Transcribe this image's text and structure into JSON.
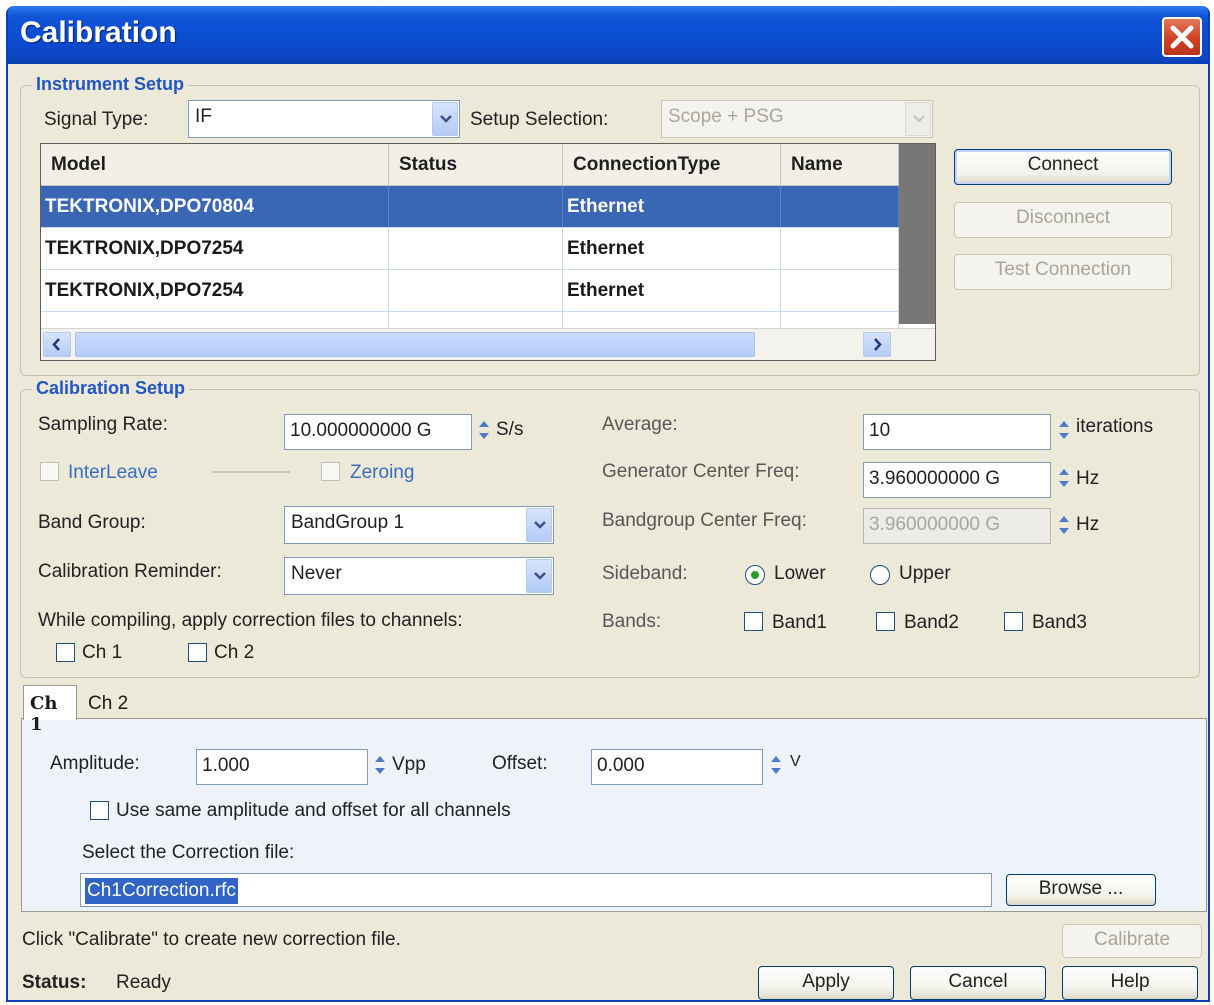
{
  "window": {
    "title": "Calibration"
  },
  "instrument_setup": {
    "title": "Instrument Setup",
    "signal_type_label": "Signal Type:",
    "signal_type_value": "IF",
    "setup_selection_label": "Setup Selection:",
    "setup_selection_value": "Scope + PSG",
    "table": {
      "columns": [
        "Model",
        "Status",
        "ConnectionType",
        "Name"
      ],
      "rows": [
        {
          "model": "TEKTRONIX,DPO70804",
          "status": "",
          "connection": "Ethernet",
          "name": ""
        },
        {
          "model": "TEKTRONIX,DPO7254",
          "status": "",
          "connection": "Ethernet",
          "name": ""
        },
        {
          "model": "TEKTRONIX,DPO7254",
          "status": "",
          "connection": "Ethernet",
          "name": ""
        }
      ]
    },
    "buttons": {
      "connect": "Connect",
      "disconnect": "Disconnect",
      "test_connection": "Test Connection"
    }
  },
  "calibration_setup": {
    "title": "Calibration Setup",
    "sampling_rate_label": "Sampling Rate:",
    "sampling_rate_value": "10.000000000 G",
    "sampling_rate_unit": "S/s",
    "interleave_label": "InterLeave",
    "zeroing_label": "Zeroing",
    "band_group_label": "Band Group:",
    "band_group_value": "BandGroup 1",
    "calibration_reminder_label": "Calibration Reminder:",
    "calibration_reminder_value": "Never",
    "apply_correction_label": "While compiling, apply correction files to channels:",
    "ch1_label": "Ch 1",
    "ch2_label": "Ch 2",
    "average_label": "Average:",
    "average_value": "10",
    "average_unit": "iterations",
    "gen_center_freq_label": "Generator Center Freq:",
    "gen_center_freq_value": "3.960000000 G",
    "gen_center_freq_unit": "Hz",
    "bandgroup_center_freq_label": "Bandgroup Center Freq:",
    "bandgroup_center_freq_value": "3.960000000 G",
    "bandgroup_center_freq_unit": "Hz",
    "sideband_label": "Sideband:",
    "sideband_lower": "Lower",
    "sideband_upper": "Upper",
    "bands_label": "Bands:",
    "band1": "Band1",
    "band2": "Band2",
    "band3": "Band3"
  },
  "tabs": {
    "ch1": "Ch 1",
    "ch2": "Ch 2"
  },
  "channel": {
    "amplitude_label": "Amplitude:",
    "amplitude_value": "1.000",
    "amplitude_unit": "Vpp",
    "offset_label": "Offset:",
    "offset_value": "0.000",
    "offset_unit": "V",
    "same_amp_label": "Use same amplitude and offset for all channels",
    "correction_file_label": "Select the Correction file:",
    "correction_file_value": "Ch1Correction.rfc",
    "browse_label": "Browse ..."
  },
  "footer": {
    "hint": "Click \"Calibrate\" to create new correction file.",
    "calibrate": "Calibrate",
    "status_label": "Status:",
    "status_value": "Ready",
    "apply": "Apply",
    "cancel": "Cancel",
    "help": "Help"
  }
}
